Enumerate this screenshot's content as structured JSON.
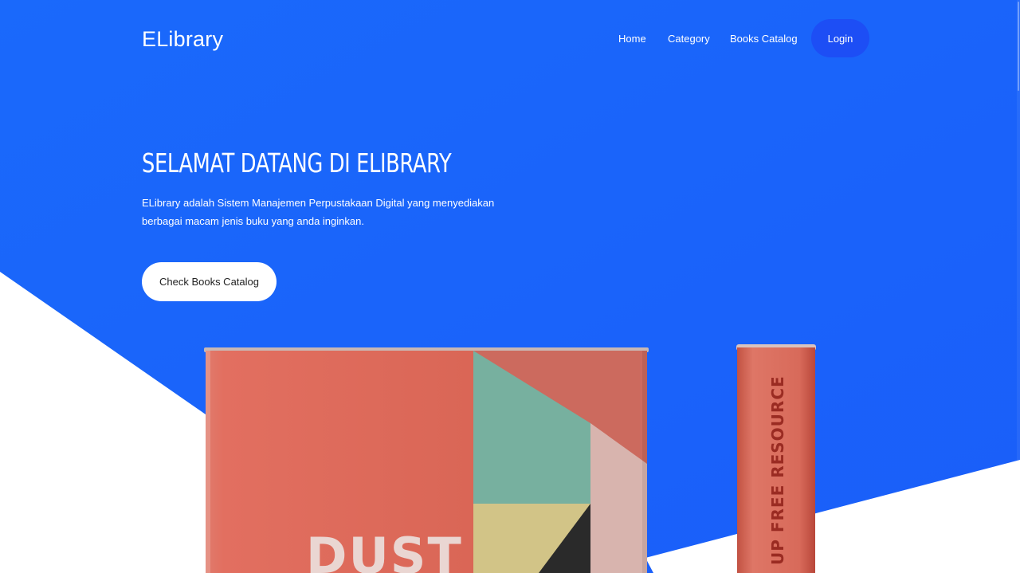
{
  "navbar": {
    "brand": "ELibrary",
    "links": [
      "Home",
      "Category",
      "Books Catalog"
    ],
    "login_label": "Login"
  },
  "hero": {
    "title": "SELAMAT DATANG DI ELIBRARY",
    "description": "ELibrary adalah Sistem Manajemen Perpustakaan Digital yang menyediakan berbagai macam jenis buku yang anda inginkan.",
    "cta_label": "Check Books Catalog"
  },
  "illustration": {
    "cover_text": "DUST",
    "spine_text": "UP FREE RESOURCE"
  },
  "colors": {
    "hero_blue": "#1a66fb",
    "login_button": "#1d4ef5",
    "book_red": "#db6a5b",
    "teal_block": "#77b09f",
    "yellow_block": "#d2c487",
    "pink_block": "#d8b4ae"
  },
  "icons": []
}
